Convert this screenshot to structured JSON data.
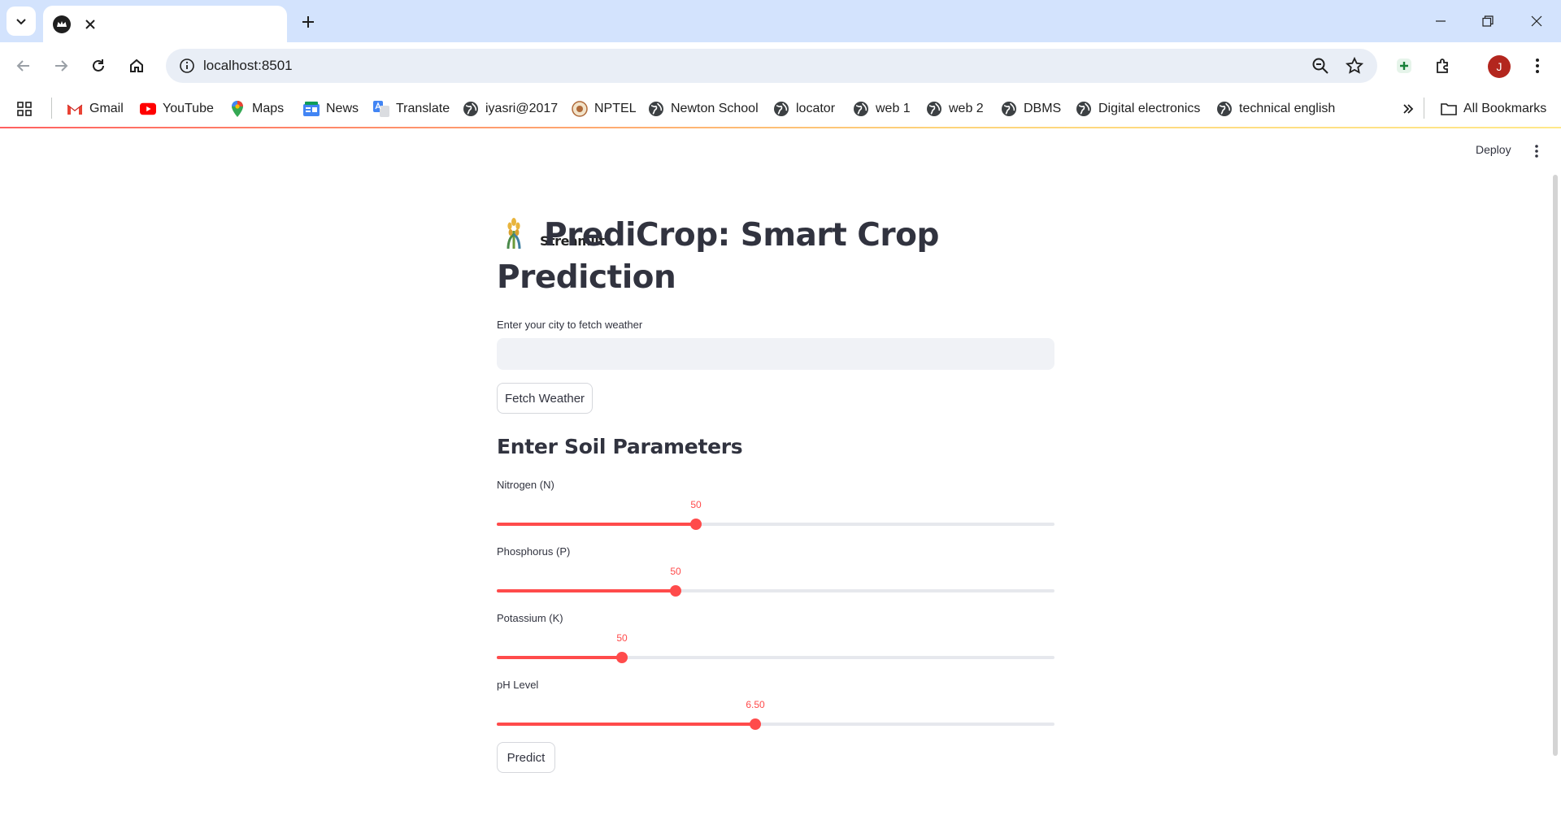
{
  "browser": {
    "tab_title": "Streamlit",
    "url": "localhost:8501",
    "avatar_letter": "J",
    "bookmarks": [
      {
        "label": "Gmail",
        "icon": "gmail-icon"
      },
      {
        "label": "YouTube",
        "icon": "youtube-icon"
      },
      {
        "label": "Maps",
        "icon": "maps-icon"
      },
      {
        "label": "News",
        "icon": "news-icon"
      },
      {
        "label": "Translate",
        "icon": "translate-icon"
      },
      {
        "label": "iyasri@2017",
        "icon": "globe-icon"
      },
      {
        "label": "NPTEL",
        "icon": "nptel-icon"
      },
      {
        "label": "Newton School",
        "icon": "globe-icon"
      },
      {
        "label": "locator",
        "icon": "globe-icon"
      },
      {
        "label": "web 1",
        "icon": "globe-icon"
      },
      {
        "label": "web 2",
        "icon": "globe-icon"
      },
      {
        "label": "DBMS",
        "icon": "globe-icon"
      },
      {
        "label": "Digital electronics",
        "icon": "globe-icon"
      },
      {
        "label": "technical english",
        "icon": "globe-icon"
      }
    ],
    "all_bookmarks_label": "All Bookmarks"
  },
  "app": {
    "deploy_label": "Deploy",
    "title": "PrediCrop: Smart Crop Prediction",
    "city_label": "Enter your city to fetch weather",
    "city_value": "",
    "fetch_button": "Fetch Weather",
    "soil_header": "Enter Soil Parameters",
    "sliders": [
      {
        "label": "Nitrogen (N)",
        "value": "50",
        "fraction": 0.357
      },
      {
        "label": "Phosphorus (P)",
        "value": "50",
        "fraction": 0.321
      },
      {
        "label": "Potassium (K)",
        "value": "50",
        "fraction": 0.224
      },
      {
        "label": "pH Level",
        "value": "6.50",
        "fraction": 0.464
      }
    ],
    "predict_button": "Predict"
  },
  "colors": {
    "accent": "#ff4b4b",
    "tabbar": "#d3e3fd",
    "text": "#31333f"
  }
}
